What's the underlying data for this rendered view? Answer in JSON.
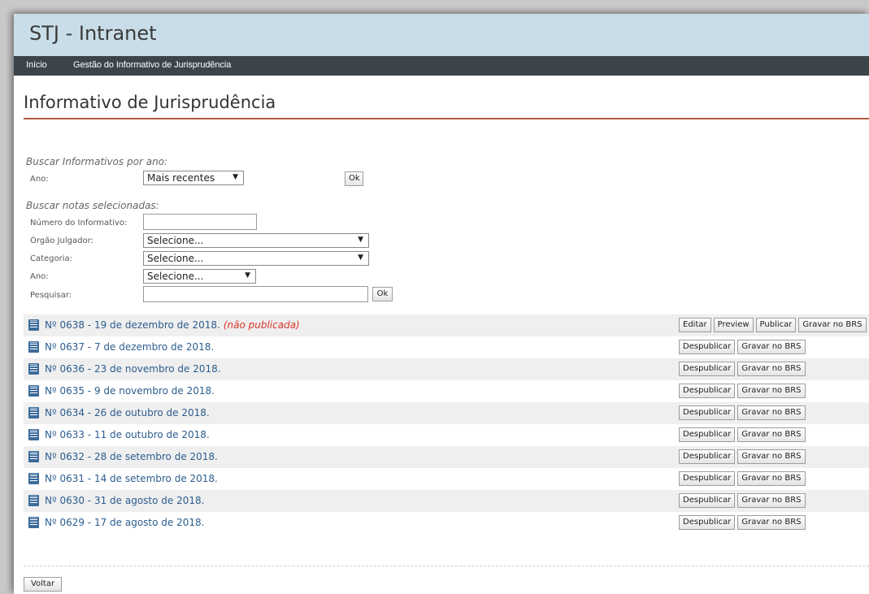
{
  "header": {
    "title": "STJ - Intranet"
  },
  "nav": {
    "items": [
      "Início",
      "Gestão do Informativo de Jurisprudência"
    ]
  },
  "page": {
    "title": "Informativo de Jurisprudência"
  },
  "search_year": {
    "section_title": "Buscar Informativos por ano:",
    "ano_label": "Ano:",
    "ano_value": "Mais recentes",
    "ok_label": "Ok"
  },
  "search_notes": {
    "section_title": "Buscar notas selecionadas:",
    "numero_label": "Número do Informativo:",
    "numero_value": "",
    "orgao_label": "Órgão Julgador:",
    "orgao_value": "Selecione...",
    "categoria_label": "Categoria:",
    "categoria_value": "Selecione...",
    "ano_label": "Ano:",
    "ano_value": "Selecione...",
    "pesquisar_label": "Pesquisar:",
    "pesquisar_value": "",
    "ok_label": "Ok"
  },
  "informativos": [
    {
      "label": "Nº 0638 - 19 de dezembro de 2018.",
      "status": "(não publicada)",
      "actions": [
        "Editar",
        "Preview",
        "Publicar",
        "Gravar no BRS"
      ]
    },
    {
      "label": "Nº 0637 - 7 de dezembro de 2018.",
      "status": "",
      "actions": [
        "Despublicar",
        "Gravar no BRS"
      ]
    },
    {
      "label": "Nº 0636 - 23 de novembro de 2018.",
      "status": "",
      "actions": [
        "Despublicar",
        "Gravar no BRS"
      ]
    },
    {
      "label": "Nº 0635 - 9 de novembro de 2018.",
      "status": "",
      "actions": [
        "Despublicar",
        "Gravar no BRS"
      ]
    },
    {
      "label": "Nº 0634 - 26 de outubro de 2018.",
      "status": "",
      "actions": [
        "Despublicar",
        "Gravar no BRS"
      ]
    },
    {
      "label": "Nº 0633 - 11 de outubro de 2018.",
      "status": "",
      "actions": [
        "Despublicar",
        "Gravar no BRS"
      ]
    },
    {
      "label": "Nº 0632 - 28 de setembro de 2018.",
      "status": "",
      "actions": [
        "Despublicar",
        "Gravar no BRS"
      ]
    },
    {
      "label": "Nº 0631 - 14 de setembro de 2018.",
      "status": "",
      "actions": [
        "Despublicar",
        "Gravar no BRS"
      ]
    },
    {
      "label": "Nº 0630 - 31 de agosto de 2018.",
      "status": "",
      "actions": [
        "Despublicar",
        "Gravar no BRS"
      ]
    },
    {
      "label": "Nº 0629 - 17 de agosto de 2018.",
      "status": "",
      "actions": [
        "Despublicar",
        "Gravar no BRS"
      ]
    }
  ],
  "footer": {
    "back_label": "Voltar"
  },
  "colors": {
    "header_bg": "#c8dde8",
    "nav_bg": "#3b4449",
    "accent_rule": "#b55a3c",
    "link": "#2c5d8f",
    "unpublished": "#d9342b"
  }
}
